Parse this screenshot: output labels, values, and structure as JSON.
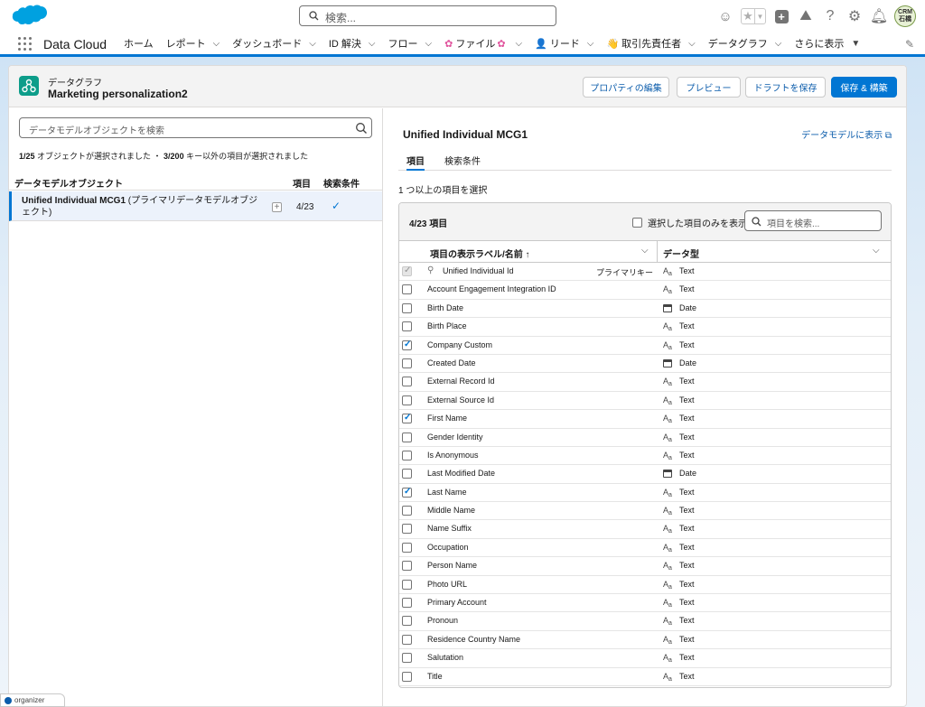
{
  "header": {
    "search_placeholder": "検索...",
    "avatar_text": "CRM\n石橋"
  },
  "nav": {
    "app_name": "Data Cloud",
    "items": [
      {
        "label": "ホーム",
        "chevron": false,
        "emoji": ""
      },
      {
        "label": "レポート",
        "chevron": true,
        "emoji": ""
      },
      {
        "label": "ダッシュボード",
        "chevron": true,
        "emoji": ""
      },
      {
        "label": "ID 解決",
        "chevron": true,
        "emoji": ""
      },
      {
        "label": "フロー",
        "chevron": true,
        "emoji": ""
      },
      {
        "label": "ファイル",
        "chevron": true,
        "emoji": "✿",
        "suffix": "✿"
      },
      {
        "label": "リード",
        "chevron": true,
        "emoji": "👤"
      },
      {
        "label": "取引先責任者",
        "chevron": true,
        "emoji": "👋"
      },
      {
        "label": "データグラフ",
        "chevron": true,
        "emoji": ""
      },
      {
        "label": "さらに表示",
        "chevron": true,
        "emoji": ""
      }
    ]
  },
  "record": {
    "eyebrow": "データグラフ",
    "title": "Marketing personalization2",
    "buttons": {
      "edit": "プロパティの編集",
      "preview": "プレビュー",
      "save_draft": "ドラフトを保存",
      "save_build": "保存 & 構築"
    }
  },
  "left": {
    "search_placeholder": "データモデルオブジェクトを検索",
    "summary_a": "1/25",
    "summary_b": " オブジェクトが選択されました ・ ",
    "summary_c": "3/200",
    "summary_d": " キー以外の項目が選択されました",
    "col_object": "データモデルオブジェクト",
    "col_fields": "項目",
    "col_search": "検索条件",
    "row": {
      "name_bold": "Unified Individual MCG1",
      "name_rest": " (プライマリデータモデルオブジェクト)",
      "count": "4/23"
    }
  },
  "right": {
    "title": "Unified Individual MCG1",
    "view_link": "データモデルに表示",
    "tabs": [
      "項目",
      "検索条件"
    ],
    "select_hint": "1 つ以上の項目を選択",
    "count": "4/23 項目",
    "only_selected": "選択した項目のみを表示",
    "field_search_placeholder": "項目を検索...",
    "col_label": "項目の表示ラベル/名前 ↑",
    "col_type": "データ型",
    "primary_key_label": "プライマリキー",
    "fields": [
      {
        "label": "Unified Individual Id",
        "type": "Text",
        "checked": true,
        "disabled": true,
        "primary": true
      },
      {
        "label": "Account Engagement Integration ID",
        "type": "Text",
        "checked": false
      },
      {
        "label": "Birth Date",
        "type": "Date",
        "checked": false
      },
      {
        "label": "Birth Place",
        "type": "Text",
        "checked": false
      },
      {
        "label": "Company Custom",
        "type": "Text",
        "checked": true
      },
      {
        "label": "Created Date",
        "type": "Date",
        "checked": false
      },
      {
        "label": "External Record Id",
        "type": "Text",
        "checked": false
      },
      {
        "label": "External Source Id",
        "type": "Text",
        "checked": false
      },
      {
        "label": "First Name",
        "type": "Text",
        "checked": true
      },
      {
        "label": "Gender Identity",
        "type": "Text",
        "checked": false
      },
      {
        "label": "Is Anonymous",
        "type": "Text",
        "checked": false
      },
      {
        "label": "Last Modified Date",
        "type": "Date",
        "checked": false
      },
      {
        "label": "Last Name",
        "type": "Text",
        "checked": true
      },
      {
        "label": "Middle Name",
        "type": "Text",
        "checked": false
      },
      {
        "label": "Name Suffix",
        "type": "Text",
        "checked": false
      },
      {
        "label": "Occupation",
        "type": "Text",
        "checked": false
      },
      {
        "label": "Person Name",
        "type": "Text",
        "checked": false
      },
      {
        "label": "Photo URL",
        "type": "Text",
        "checked": false
      },
      {
        "label": "Primary Account",
        "type": "Text",
        "checked": false
      },
      {
        "label": "Pronoun",
        "type": "Text",
        "checked": false
      },
      {
        "label": "Residence Country Name",
        "type": "Text",
        "checked": false
      },
      {
        "label": "Salutation",
        "type": "Text",
        "checked": false
      },
      {
        "label": "Title",
        "type": "Text",
        "checked": false
      }
    ]
  },
  "footer": {
    "organizer": "organizer"
  },
  "colors": {
    "brand": "#0176d3",
    "link": "#0b5cab",
    "object_icon": "#0d9d8a"
  }
}
